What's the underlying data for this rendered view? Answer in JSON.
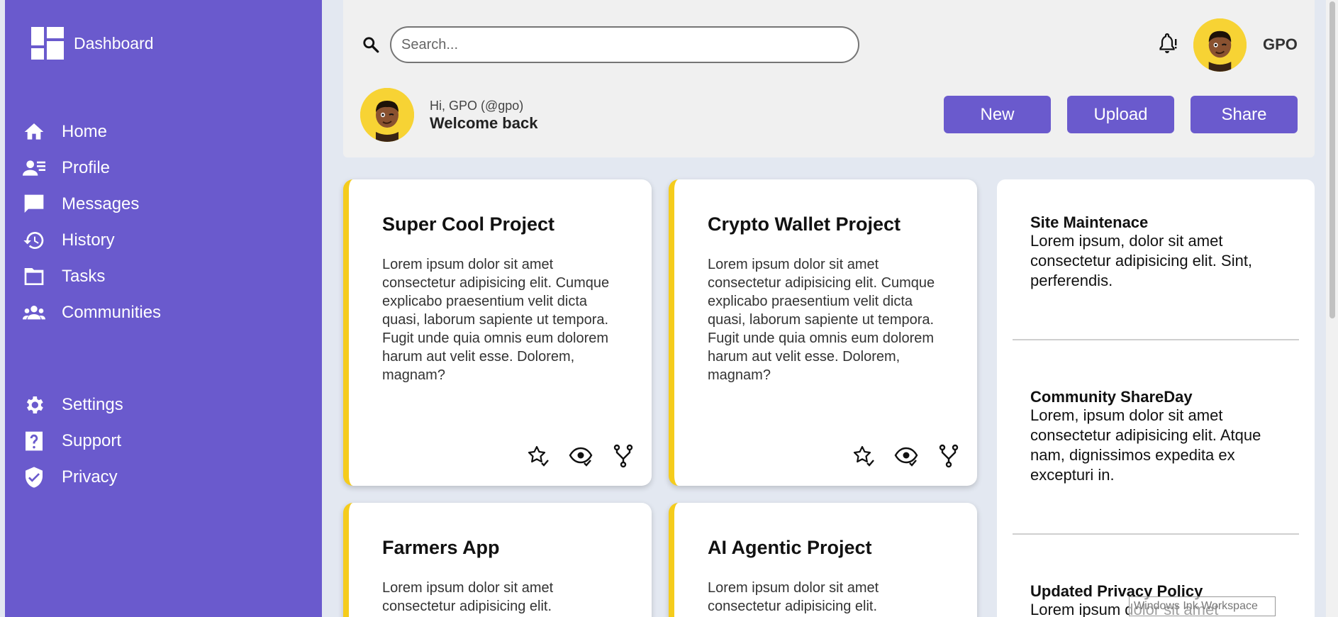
{
  "sidebar": {
    "brand": "Dashboard",
    "items": [
      {
        "label": "Home",
        "icon": "home-icon"
      },
      {
        "label": "Profile",
        "icon": "profile-icon"
      },
      {
        "label": "Messages",
        "icon": "messages-icon"
      },
      {
        "label": "History",
        "icon": "history-icon"
      },
      {
        "label": "Tasks",
        "icon": "tasks-icon"
      },
      {
        "label": "Communities",
        "icon": "communities-icon"
      }
    ],
    "bottom_items": [
      {
        "label": "Settings",
        "icon": "gear-icon"
      },
      {
        "label": "Support",
        "icon": "help-icon"
      },
      {
        "label": "Privacy",
        "icon": "shield-icon"
      }
    ]
  },
  "header": {
    "search_placeholder": "Search...",
    "user": "GPO",
    "greeting": "Hi, GPO (@gpo)",
    "welcome": "Welcome back",
    "buttons": {
      "new": "New",
      "upload": "Upload",
      "share": "Share"
    }
  },
  "projects": [
    {
      "title": "Super Cool Project",
      "description": "Lorem ipsum dolor sit amet consectetur adipisicing elit. Cumque explicabo praesentium velit dicta quasi, laborum sapiente ut tempora. Fugit unde quia omnis eum dolorem harum aut velit esse. Dolorem, magnam?"
    },
    {
      "title": "Crypto Wallet Project",
      "description": "Lorem ipsum dolor sit amet consectetur adipisicing elit. Cumque explicabo praesentium velit dicta quasi, laborum sapiente ut tempora. Fugit unde quia omnis eum dolorem harum aut velit esse. Dolorem, magnam?"
    },
    {
      "title": "Farmers App",
      "description": "Lorem ipsum dolor sit amet consectetur adipisicing elit."
    },
    {
      "title": "AI Agentic Project",
      "description": "Lorem ipsum dolor sit amet consectetur adipisicing elit."
    }
  ],
  "notices": [
    {
      "title": "Site Maintenace",
      "body": "Lorem ipsum, dolor sit amet consectetur adipisicing elit. Sint, perferendis."
    },
    {
      "title": "Community ShareDay",
      "body": "Lorem, ipsum dolor sit amet consectetur adipisicing elit. Atque nam, dignissimos expedita ex excepturi in."
    },
    {
      "title": "Updated Privacy Policy",
      "body": "Lorem ipsum dolor sit amet"
    }
  ],
  "overlay": {
    "watermark": "Windows Ink Workspace"
  },
  "colors": {
    "accent": "#6a5acd",
    "card_border": "#f5cc1c",
    "avatar_bg": "#f7d334",
    "background": "#e3e8f1"
  }
}
